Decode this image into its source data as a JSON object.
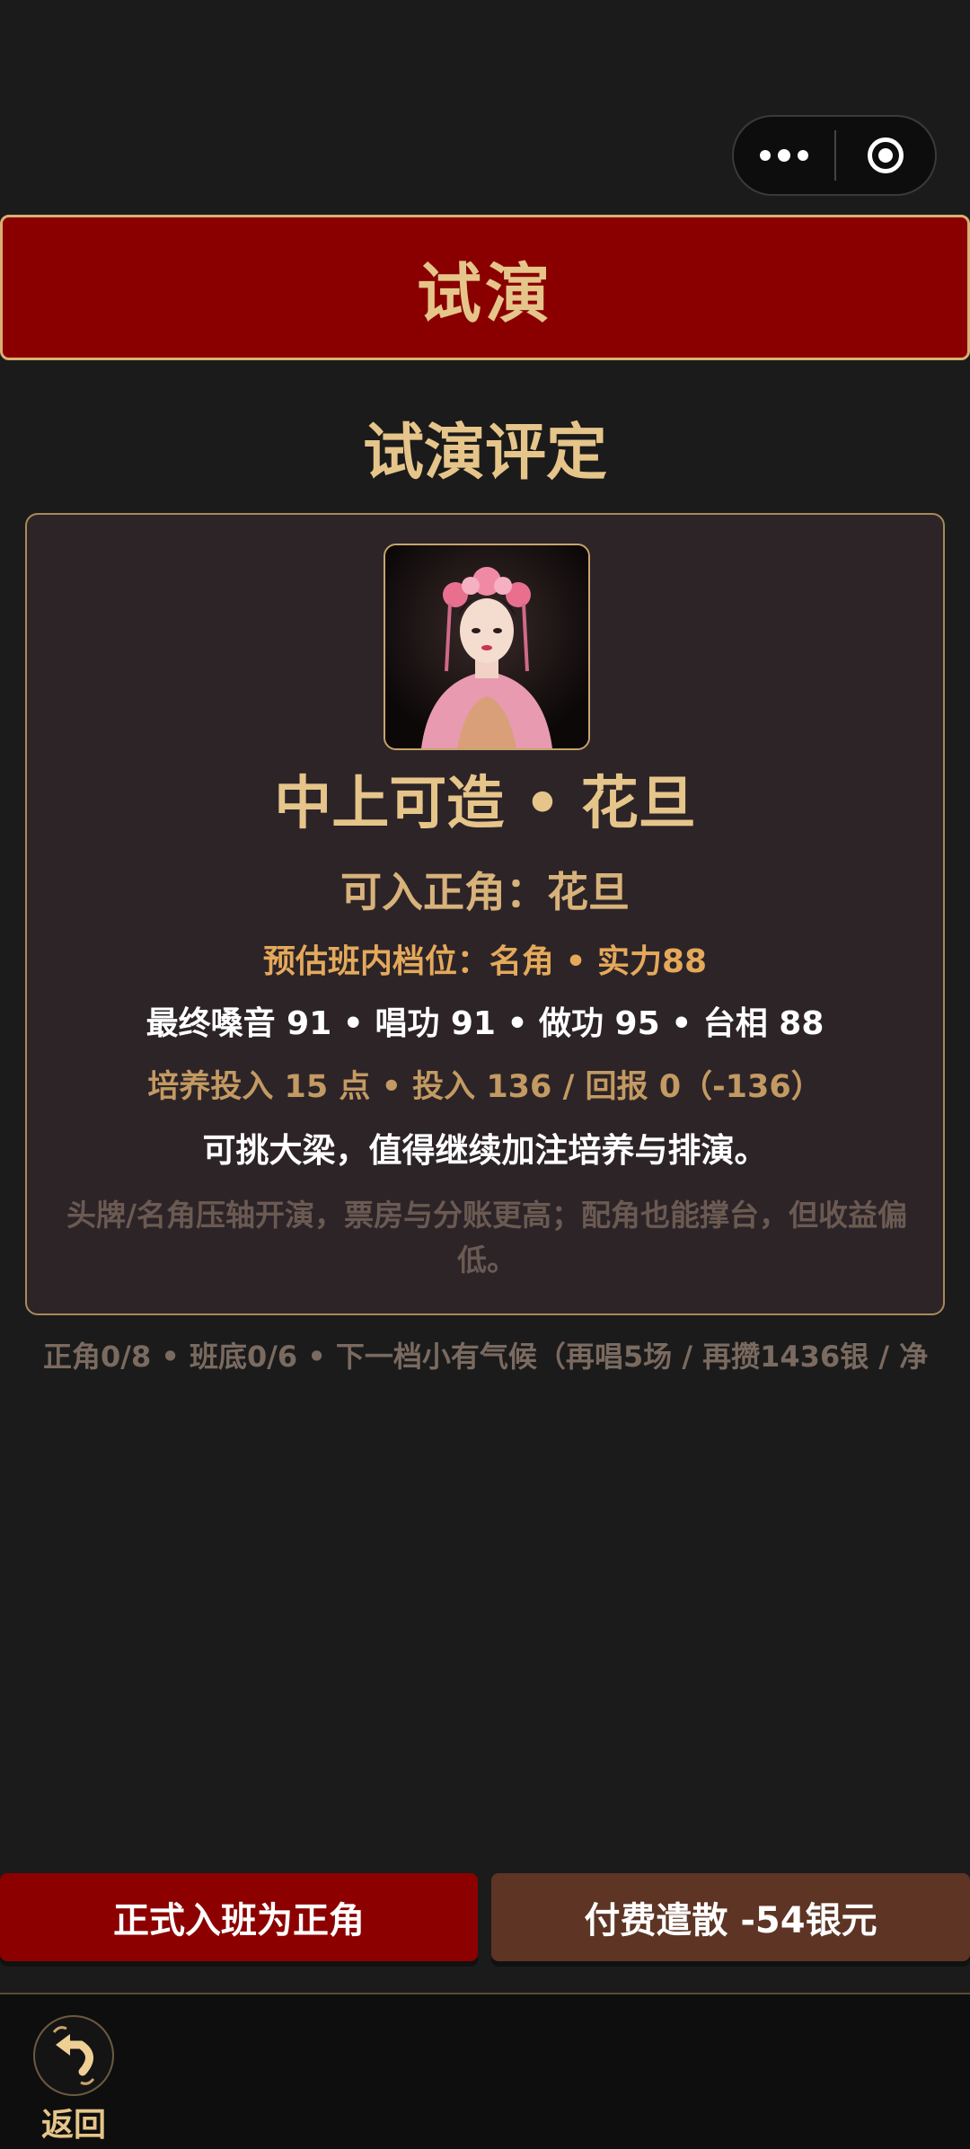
{
  "capsule": {
    "more_icon": "more-dots-icon",
    "target_icon": "target-icon"
  },
  "header": {
    "title": "试演"
  },
  "section": {
    "title": "试演评定"
  },
  "card": {
    "portrait_icon": "opera-actress-portrait",
    "grade": "中上可造 • 花旦",
    "role": "可入正角：花旦",
    "tier": "预估班内档位：名角 • 实力88",
    "stats": "最终嗓音 91 • 唱功 91 • 做功 95 • 台相 88",
    "investment": "培养投入 15 点 • 投入 136 / 回报 0（-136）",
    "verdict": "可挑大梁，值得继续加注培养与排演。",
    "description": "头牌/名角压轴开演，票房与分账更高；配角也能撑台，但收益偏低。"
  },
  "status_line": "正角0/8 • 班底0/6 • 下一档小有气候（再唱5场 / 再攒1436银 / 净",
  "actions": {
    "confirm_label": "正式入班为正角",
    "dismiss_label": "付费遣散 -54银元"
  },
  "tabbar": {
    "back_label": "返回",
    "back_icon": "back-arrow-icon"
  },
  "colors": {
    "background": "#1b1b1b",
    "banner": "#8a0000",
    "gold": "#e6c58a",
    "card": "#2d2428",
    "primary_button": "#8c0000",
    "secondary_button": "#5e3424"
  }
}
